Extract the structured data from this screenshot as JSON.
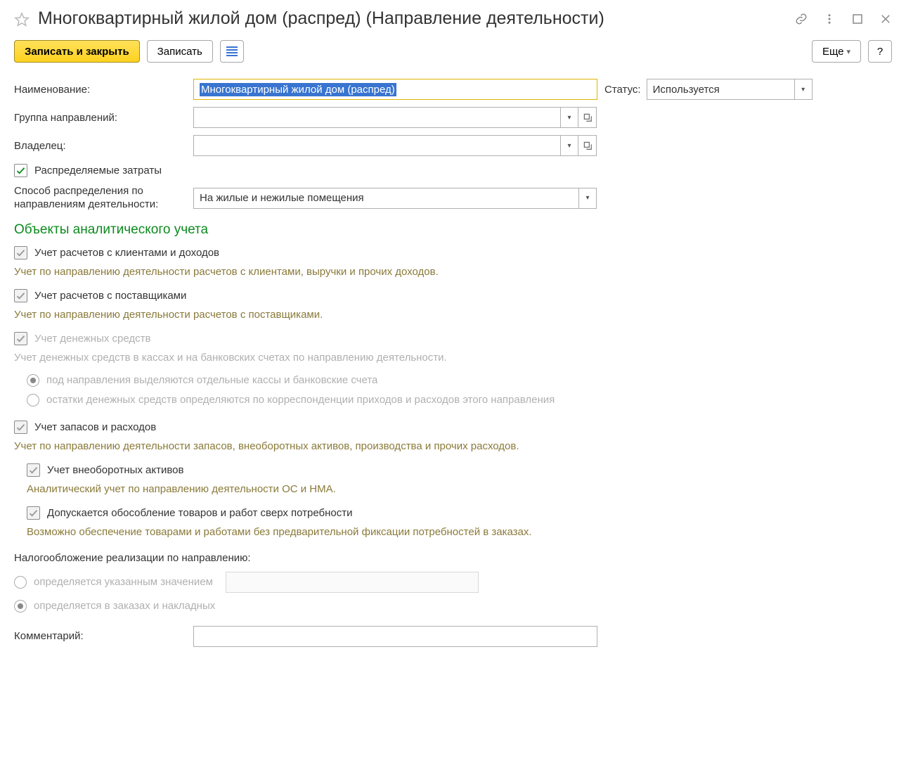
{
  "window": {
    "title": "Многоквартирный жилой дом (распред) (Направление деятельности)"
  },
  "toolbar": {
    "save_and_close": "Записать и закрыть",
    "save": "Записать",
    "more": "Еще",
    "help": "?"
  },
  "fields": {
    "name_label": "Наименование:",
    "name_value": "Многоквартирный жилой дом (распред)",
    "status_label": "Статус:",
    "status_value": "Используется",
    "group_label": "Группа направлений:",
    "group_value": "",
    "owner_label": "Владелец:",
    "owner_value": "",
    "dist_costs_label": "Распределяемые затраты",
    "dist_method_label": "Способ распределения по направлениям деятельности:",
    "dist_method_value": "На жилые и нежилые помещения",
    "comment_label": "Комментарий:",
    "comment_value": ""
  },
  "section": {
    "heading": "Объекты аналитического учета",
    "clients": {
      "label": "Учет расчетов с клиентами и доходов",
      "desc": "Учет по направлению деятельности расчетов с клиентами, выручки и прочих доходов."
    },
    "suppliers": {
      "label": "Учет расчетов с поставщиками",
      "desc": "Учет по направлению деятельности расчетов с поставщиками."
    },
    "cash": {
      "label": "Учет денежных средств",
      "desc": "Учет денежных средств в кассах и на банковских счетах по направлению деятельности.",
      "opt1": "под направления выделяются отдельные кассы и банковские счета",
      "opt2": "остатки денежных средств определяются по корреспонденции приходов и расходов этого направления"
    },
    "stock": {
      "label": "Учет запасов и расходов",
      "desc": "Учет по направлению деятельности запасов, внеоборотных активов, производства и прочих расходов."
    },
    "fixed_assets": {
      "label": "Учет внеоборотных активов",
      "desc": "Аналитический учет по направлению деятельности ОС и НМА."
    },
    "over_demand": {
      "label": "Допускается обособление товаров и работ сверх потребности",
      "desc": "Возможно обеспечение товарами и работами без предварительной фиксации потребностей в заказах."
    }
  },
  "tax": {
    "heading": "Налогообложение реализации по направлению:",
    "opt_value": "определяется указанным значением",
    "opt_orders": "определяется в заказах и накладных"
  }
}
